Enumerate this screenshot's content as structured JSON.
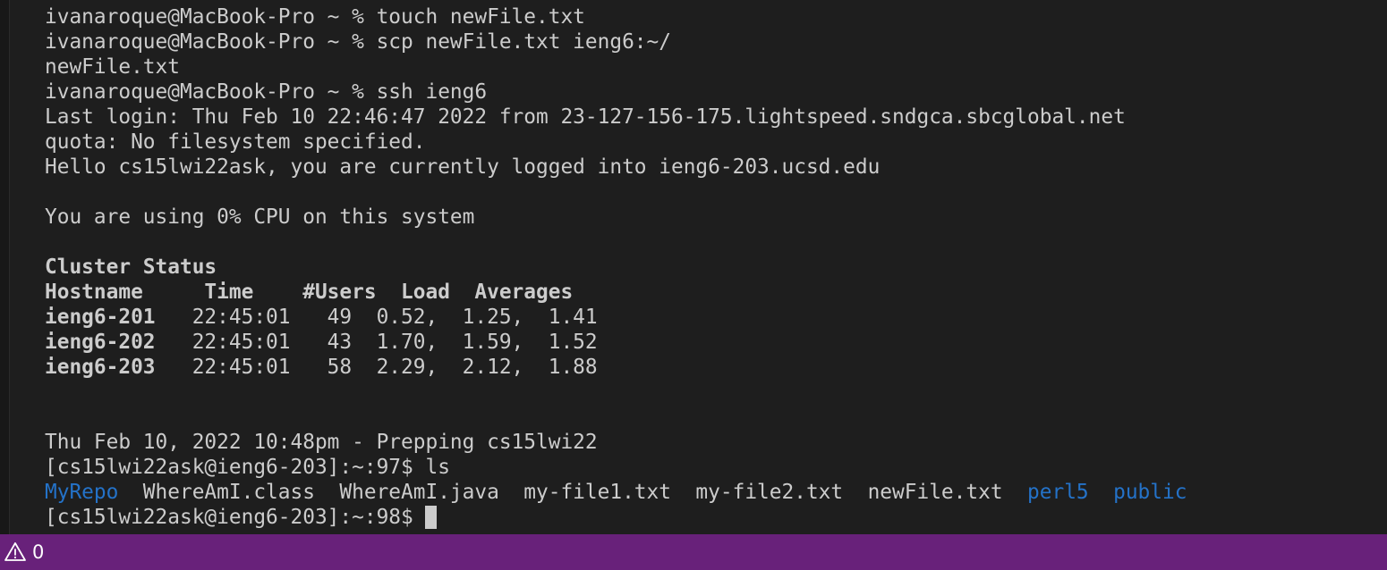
{
  "terminal": {
    "lines": [
      {
        "segments": [
          {
            "text": "ivanaroque@MacBook-Pro ~ % touch newFile.txt"
          }
        ]
      },
      {
        "segments": [
          {
            "text": "ivanaroque@MacBook-Pro ~ % scp newFile.txt ieng6:~/"
          }
        ]
      },
      {
        "segments": [
          {
            "text": "newFile.txt"
          }
        ]
      },
      {
        "segments": [
          {
            "text": "ivanaroque@MacBook-Pro ~ % ssh ieng6"
          }
        ]
      },
      {
        "segments": [
          {
            "text": "Last login: Thu Feb 10 22:46:47 2022 from 23-127-156-175.lightspeed.sndgca.sbcglobal.net"
          }
        ]
      },
      {
        "segments": [
          {
            "text": "quota: No filesystem specified."
          }
        ]
      },
      {
        "segments": [
          {
            "text": "Hello cs15lwi22ask, you are currently logged into ieng6-203.ucsd.edu"
          }
        ]
      },
      {
        "segments": [
          {
            "text": ""
          }
        ]
      },
      {
        "segments": [
          {
            "text": "You are using 0% CPU on this system"
          }
        ]
      },
      {
        "segments": [
          {
            "text": ""
          }
        ]
      },
      {
        "segments": [
          {
            "text": "Cluster Status",
            "bold": true
          }
        ]
      },
      {
        "segments": [
          {
            "text": "Hostname     Time    #Users  Load  Averages",
            "bold": true
          }
        ]
      },
      {
        "segments": [
          {
            "text": "ieng6-201",
            "bold": true
          },
          {
            "text": "   22:45:01   49  0.52,  1.25,  1.41"
          }
        ]
      },
      {
        "segments": [
          {
            "text": "ieng6-202",
            "bold": true
          },
          {
            "text": "   22:45:01   43  1.70,  1.59,  1.52"
          }
        ]
      },
      {
        "segments": [
          {
            "text": "ieng6-203",
            "bold": true
          },
          {
            "text": "   22:45:01   58  2.29,  2.12,  1.88"
          }
        ]
      },
      {
        "segments": [
          {
            "text": ""
          }
        ]
      },
      {
        "segments": [
          {
            "text": ""
          }
        ]
      },
      {
        "segments": [
          {
            "text": "Thu Feb 10, 2022 10:48pm - Prepping cs15lwi22"
          }
        ]
      },
      {
        "segments": [
          {
            "text": "[cs15lwi22ask@ieng6-203]:~:97$ ls"
          }
        ]
      },
      {
        "segments": [
          {
            "text": "MyRepo",
            "dir": true
          },
          {
            "text": "  WhereAmI.class  WhereAmI.java  my-file1.txt  my-file2.txt  newFile.txt  "
          },
          {
            "text": "perl5",
            "dir": true
          },
          {
            "text": "  "
          },
          {
            "text": "public",
            "dir": true
          }
        ]
      },
      {
        "segments": [
          {
            "text": "[cs15lwi22ask@ieng6-203]:~:98$ "
          }
        ],
        "cursor": true
      }
    ]
  },
  "status_bar": {
    "problems_icon": "warning-icon",
    "problems_count": "0",
    "background": "#68217a"
  },
  "colors": {
    "terminal_bg": "#1e1e1e",
    "terminal_fg": "#cccccc",
    "directory": "#2472c8"
  }
}
